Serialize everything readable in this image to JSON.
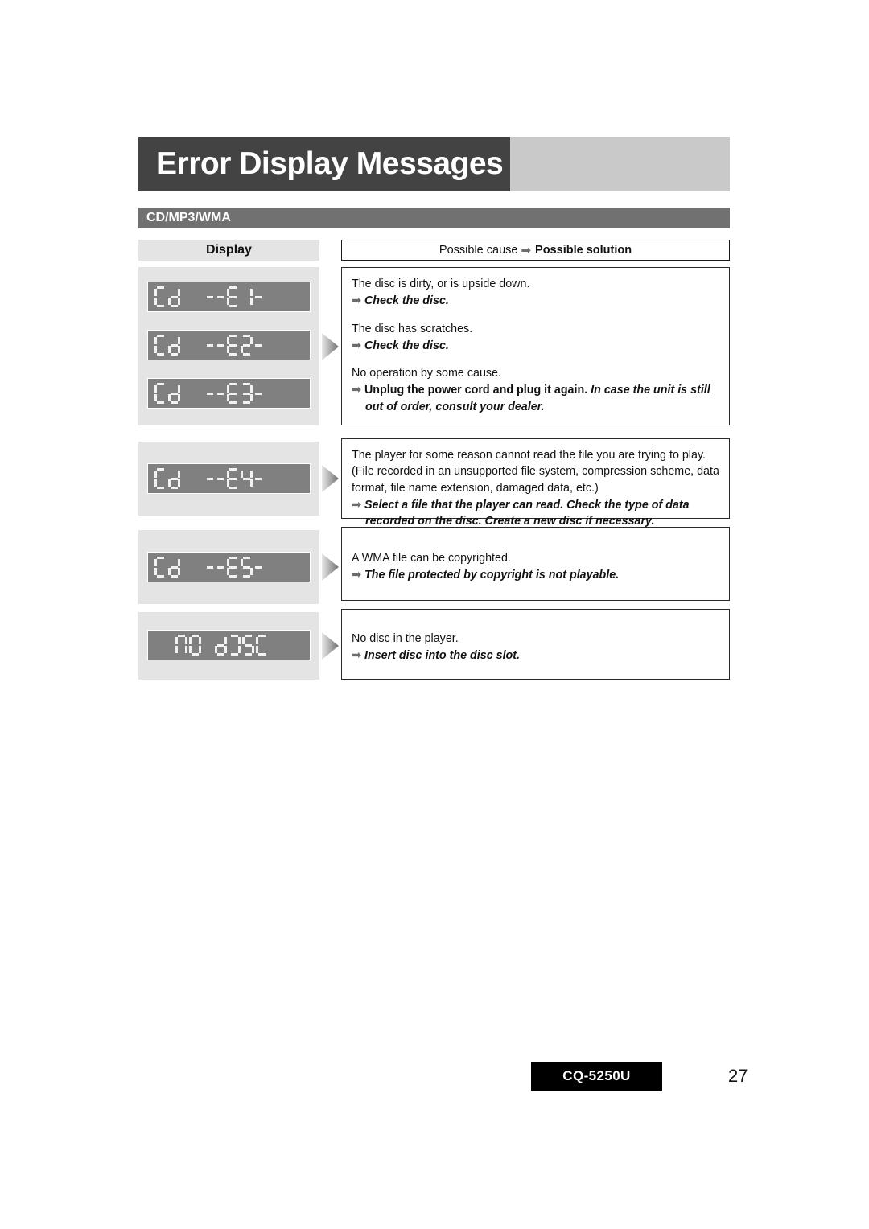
{
  "page": {
    "title": "Error Display Messages",
    "section": "CD/MP3/WMA",
    "model": "CQ-5250U",
    "page_number": "27"
  },
  "colors": {
    "title_dark": "#434343",
    "title_light": "#c9c9c9",
    "section_band": "#717171",
    "cell_bg": "#e4e4e4",
    "lcd_bg": "#808080",
    "lcd_segment": "#f2f2f2",
    "arrow": "#6d6d6d",
    "footer_bg": "#000000"
  },
  "headers": {
    "display": "Display",
    "cause_prefix": "Possible cause",
    "cause_arrow": "➡",
    "cause_suffix": "Possible solution"
  },
  "rows": [
    {
      "displays": [
        "CD --E1--",
        "CD --E2--",
        "CD --E3--"
      ],
      "blocks": [
        {
          "cause": "The disc is dirty, or is upside down.",
          "solution": "Check the disc.",
          "solution_tail": ""
        },
        {
          "cause": "The disc has scratches.",
          "solution": "Check the disc.",
          "solution_tail": ""
        },
        {
          "cause": "No operation by some cause.",
          "solution": "Unplug the power cord and plug it again.",
          "solution_tail": "In case the unit is still out of order, consult your dealer."
        }
      ]
    },
    {
      "displays": [
        "CD --E4--"
      ],
      "blocks": [
        {
          "cause": "The player for some reason cannot read the file you are trying to play. (File recorded in an unsupported file system, compression scheme, data format, file name extension, damaged data, etc.)",
          "solution": "Select a file that the player can read. Check the type of data recorded on the disc. Create a new disc if necessary.",
          "solution_tail": ""
        }
      ]
    },
    {
      "displays": [
        "CD --E5--"
      ],
      "blocks": [
        {
          "cause": "A WMA file can be copyrighted.",
          "solution": "The file protected by copyright is not playable.",
          "solution_tail": ""
        }
      ]
    },
    {
      "displays": [
        "NO DISC"
      ],
      "blocks": [
        {
          "cause": "No disc in the player.",
          "solution": "Insert disc into the disc slot.",
          "solution_tail": ""
        }
      ]
    }
  ]
}
